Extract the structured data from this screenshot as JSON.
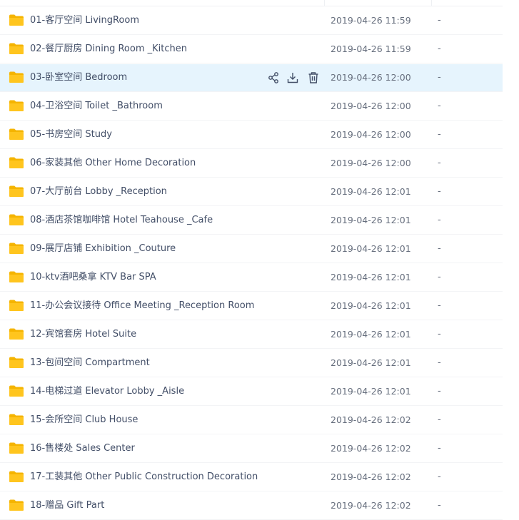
{
  "colors": {
    "folder": "#ffc51e",
    "highlight": "#e6f4fd",
    "text": "#424e67",
    "muted": "#666e7d"
  },
  "row_actions": [
    "share-icon",
    "download-icon",
    "delete-icon"
  ],
  "files": [
    {
      "name": "01-客厅空间 LivingRoom",
      "date": "2019-04-26 11:59",
      "size": "-"
    },
    {
      "name": "02-餐厅厨房 Dining Room _Kitchen",
      "date": "2019-04-26 11:59",
      "size": "-"
    },
    {
      "name": "03-卧室空间 Bedroom",
      "date": "2019-04-26 12:00",
      "size": "-",
      "highlighted": true
    },
    {
      "name": "04-卫浴空间 Toilet _Bathroom",
      "date": "2019-04-26 12:00",
      "size": "-"
    },
    {
      "name": "05-书房空间 Study",
      "date": "2019-04-26 12:00",
      "size": "-"
    },
    {
      "name": "06-家装其他 Other Home Decoration",
      "date": "2019-04-26 12:00",
      "size": "-"
    },
    {
      "name": "07-大厅前台 Lobby _Reception",
      "date": "2019-04-26 12:01",
      "size": "-"
    },
    {
      "name": "08-酒店茶馆咖啡馆 Hotel  Teahouse _Cafe",
      "date": "2019-04-26 12:01",
      "size": "-"
    },
    {
      "name": "09-展厅店铺 Exhibition _Couture",
      "date": "2019-04-26 12:01",
      "size": "-"
    },
    {
      "name": "10-ktv酒吧桑拿 KTV  Bar SPA",
      "date": "2019-04-26 12:01",
      "size": "-"
    },
    {
      "name": "11-办公会议接待 Office  Meeting _Reception Room",
      "date": "2019-04-26 12:01",
      "size": "-"
    },
    {
      "name": "12-宾馆套房 Hotel Suite",
      "date": "2019-04-26 12:01",
      "size": "-"
    },
    {
      "name": "13-包间空间 Compartment",
      "date": "2019-04-26 12:01",
      "size": "-"
    },
    {
      "name": "14-电梯过道 Elevator Lobby _Aisle",
      "date": "2019-04-26 12:01",
      "size": "-"
    },
    {
      "name": "15-会所空间 Club House",
      "date": "2019-04-26 12:02",
      "size": "-"
    },
    {
      "name": "16-售楼处 Sales Center",
      "date": "2019-04-26 12:02",
      "size": "-"
    },
    {
      "name": "17-工装其他 Other Public Construction Decoration",
      "date": "2019-04-26 12:02",
      "size": "-"
    },
    {
      "name": "18-赠品 Gift Part",
      "date": "2019-04-26 12:02",
      "size": "-"
    }
  ]
}
